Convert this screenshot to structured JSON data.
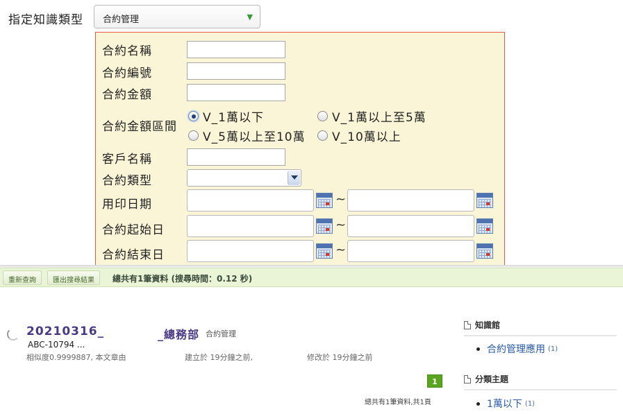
{
  "knowledge_type": {
    "label": "指定知識類型",
    "selected": "合約管理"
  },
  "form": {
    "contract_name": "合約名稱",
    "contract_no": "合約編號",
    "contract_amount": "合約金額",
    "amount_range": {
      "label": "合約金額區間",
      "options": [
        "V_1萬以下",
        "V_1萬以上至5萬",
        "V_5萬以上至10萬",
        "V_10萬以上"
      ],
      "selected_index": 0
    },
    "customer_name": "客戶名稱",
    "contract_type": "合約類型",
    "seal_date": "用印日期",
    "start_date": "合約起始日",
    "end_date": "合約結束日",
    "tilde": "~"
  },
  "toolbar": {
    "requery": "重新查詢",
    "export": "匯出搜尋結果",
    "summary": "總共有1筆資料 (搜尋時間：0.12 秒)"
  },
  "result": {
    "title": "20210316_",
    "dept": "_總務部",
    "category": "合約管理",
    "code": "ABC-10794 ...",
    "similarity": "相似度0.9999887, 本文章由",
    "created": "建立於 19分鐘之前,",
    "modified": "修改於 19分鐘之前"
  },
  "pagination": {
    "page": "1",
    "total": "總共有1筆資料,共1頁"
  },
  "sidebar": {
    "library_title": "知識館",
    "library_items": [
      {
        "label": "合約管理應用",
        "count": "(1)"
      }
    ],
    "topic_title": "分類主題",
    "topic_items": [
      {
        "label": "1萬以下",
        "count": "(1)"
      }
    ]
  },
  "colors": {
    "form_bg": "#fbf5d8",
    "form_border": "#e55a4a",
    "toolbar_bg": "#eaf4d6",
    "title_purple": "#4a3a86",
    "link_blue": "#2a5aa8",
    "pager_green": "#5aa51e"
  },
  "icons": [
    "dropdown-arrow-icon",
    "calendar-icon",
    "spinner-icon",
    "document-icon"
  ]
}
